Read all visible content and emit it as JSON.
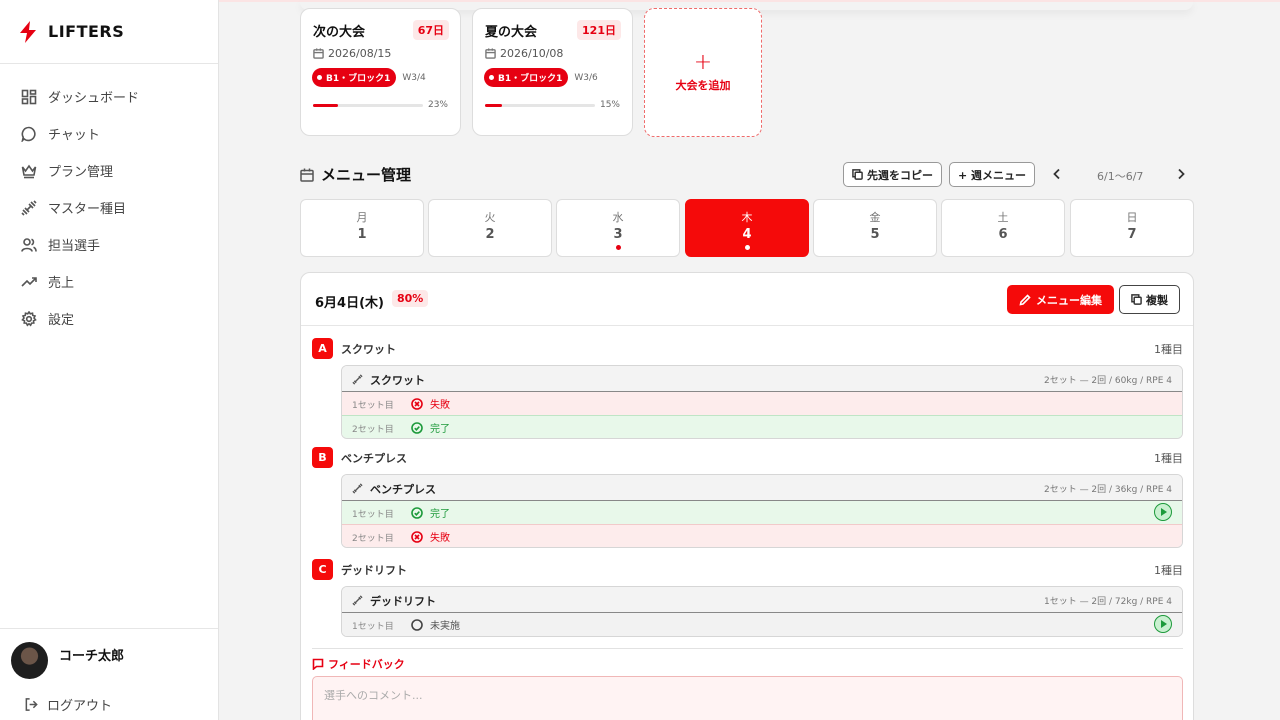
{
  "app": {
    "brand": "LIFTERS"
  },
  "sidebar": {
    "items": [
      {
        "label": "ダッシュボード",
        "icon": "dashboard-icon"
      },
      {
        "label": "チャット",
        "icon": "chat-icon"
      },
      {
        "label": "プラン管理",
        "icon": "crown-icon"
      },
      {
        "label": "マスター種目",
        "icon": "dumbbell-icon"
      },
      {
        "label": "担当選手",
        "icon": "users-icon"
      },
      {
        "label": "売上",
        "icon": "trend-icon"
      },
      {
        "label": "設定",
        "icon": "gear-icon"
      }
    ],
    "user_name": "コーチ太郎",
    "logout_label": "ログアウト"
  },
  "competitions": [
    {
      "title": "次の大会",
      "days": "67日",
      "date": "2026/08/15",
      "block": "B1・ブロック1",
      "week": "W3/4",
      "progress": 0.23,
      "pct": "23%"
    },
    {
      "title": "夏の大会",
      "days": "121日",
      "date": "2026/10/08",
      "block": "B1・ブロック1",
      "week": "W3/6",
      "progress": 0.15,
      "pct": "15%"
    }
  ],
  "add_competition": {
    "plus": "+",
    "label": "大会を追加"
  },
  "menu": {
    "title": "メニュー管理",
    "copy_label": "先週をコピー",
    "week_menu_label": "+ 週メニュー",
    "week_range": "6/1〜6/7"
  },
  "days": [
    {
      "name": "月",
      "num": "1",
      "has_dot": false
    },
    {
      "name": "火",
      "num": "2",
      "has_dot": false
    },
    {
      "name": "水",
      "num": "3",
      "has_dot": true
    },
    {
      "name": "木",
      "num": "4",
      "has_dot": true,
      "active": true
    },
    {
      "name": "金",
      "num": "5",
      "has_dot": false
    },
    {
      "name": "土",
      "num": "6",
      "has_dot": false
    },
    {
      "name": "日",
      "num": "7",
      "has_dot": false
    }
  ],
  "panel": {
    "date": "6月4日(木)",
    "pct": "80%",
    "edit_label": "メニュー編集",
    "duplicate_label": "複製"
  },
  "exercises": [
    {
      "letter": "A",
      "name": "スクワット",
      "count": "1種目",
      "box_name": "スクワット",
      "info": "2セット — 2回 / 60kg / RPE 4",
      "sets": [
        {
          "label": "1セット目",
          "status": "失敗",
          "state": "fail",
          "play": false
        },
        {
          "label": "2セット目",
          "status": "完了",
          "state": "done",
          "play": false
        }
      ]
    },
    {
      "letter": "B",
      "name": "ベンチプレス",
      "count": "1種目",
      "box_name": "ベンチプレス",
      "info": "2セット — 2回 / 36kg / RPE 4",
      "sets": [
        {
          "label": "1セット目",
          "status": "完了",
          "state": "done",
          "play": true
        },
        {
          "label": "2セット目",
          "status": "失敗",
          "state": "fail",
          "play": false
        }
      ]
    },
    {
      "letter": "C",
      "name": "デッドリフト",
      "count": "1種目",
      "box_name": "デッドリフト",
      "info": "1セット — 2回 / 72kg / RPE 4",
      "sets": [
        {
          "label": "1セット目",
          "status": "未実施",
          "state": "pending",
          "play": true
        }
      ]
    }
  ],
  "feedback": {
    "label": "フィードバック",
    "placeholder": "選手へのコメント..."
  },
  "colors": {
    "accent": "#f50a0a",
    "success": "#1d9a3b",
    "fail_bg": "#fdecec",
    "done_bg": "#e8f8ea"
  }
}
